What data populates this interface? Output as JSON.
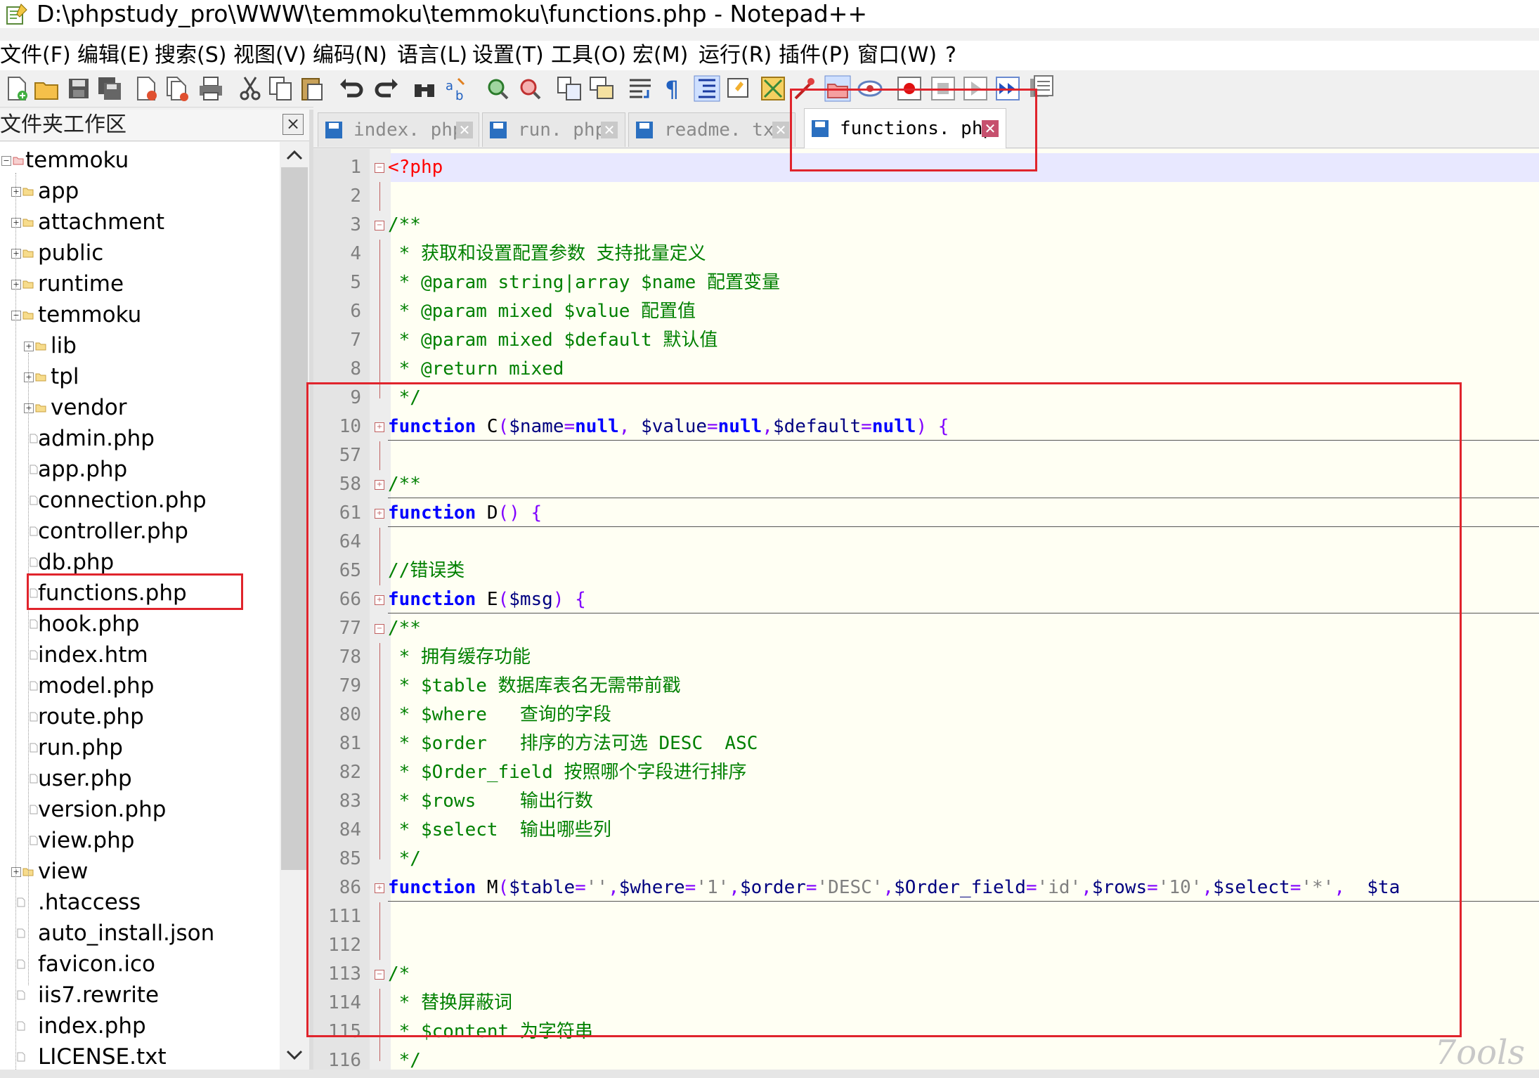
{
  "window": {
    "title": "D:\\phpstudy_pro\\WWW\\temmoku\\temmoku\\functions.php - Notepad++"
  },
  "menu": [
    "文件(F)",
    "编辑(E)",
    "搜索(S)",
    "视图(V)",
    "编码(N)",
    "语言(L)",
    "设置(T)",
    "工具(O)",
    "宏(M)",
    "运行(R)",
    "插件(P)",
    "窗口(W)",
    "?"
  ],
  "toolbar_icons": [
    "new-file-icon",
    "open-file-icon",
    "save-icon",
    "save-all-icon",
    "close-icon",
    "close-all-icon",
    "print-icon",
    "cut-icon",
    "copy-icon",
    "paste-icon",
    "undo-icon",
    "redo-icon",
    "find-icon",
    "replace-icon",
    "zoom-in-icon",
    "zoom-out-icon",
    "sync-vertical-icon",
    "sync-horizontal-icon",
    "word-wrap-icon",
    "show-all-chars-icon",
    "indent-guide-icon",
    "user-language-icon",
    "document-map-icon",
    "function-list-icon",
    "folder-workspace-icon",
    "monitoring-icon",
    "record-macro-icon",
    "stop-macro-icon",
    "play-macro-icon",
    "run-macro-multiple-icon",
    "save-macro-icon"
  ],
  "workspace": {
    "title": "文件夹工作区",
    "close_label": "×",
    "tree": [
      {
        "label": "temmoku",
        "depth": 0,
        "type": "root-open"
      },
      {
        "label": "app",
        "depth": 1,
        "type": "folder"
      },
      {
        "label": "attachment",
        "depth": 1,
        "type": "folder"
      },
      {
        "label": "public",
        "depth": 1,
        "type": "folder"
      },
      {
        "label": "runtime",
        "depth": 1,
        "type": "folder"
      },
      {
        "label": "temmoku",
        "depth": 1,
        "type": "folder-open"
      },
      {
        "label": "lib",
        "depth": 2,
        "type": "folder"
      },
      {
        "label": "tpl",
        "depth": 2,
        "type": "folder"
      },
      {
        "label": "vendor",
        "depth": 2,
        "type": "folder"
      },
      {
        "label": "admin.php",
        "depth": 2,
        "type": "file"
      },
      {
        "label": "app.php",
        "depth": 2,
        "type": "file"
      },
      {
        "label": "connection.php",
        "depth": 2,
        "type": "file"
      },
      {
        "label": "controller.php",
        "depth": 2,
        "type": "file"
      },
      {
        "label": "db.php",
        "depth": 2,
        "type": "file"
      },
      {
        "label": "functions.php",
        "depth": 2,
        "type": "file"
      },
      {
        "label": "hook.php",
        "depth": 2,
        "type": "file"
      },
      {
        "label": "index.htm",
        "depth": 2,
        "type": "file"
      },
      {
        "label": "model.php",
        "depth": 2,
        "type": "file"
      },
      {
        "label": "route.php",
        "depth": 2,
        "type": "file"
      },
      {
        "label": "run.php",
        "depth": 2,
        "type": "file"
      },
      {
        "label": "user.php",
        "depth": 2,
        "type": "file"
      },
      {
        "label": "version.php",
        "depth": 2,
        "type": "file"
      },
      {
        "label": "view.php",
        "depth": 2,
        "type": "file"
      },
      {
        "label": "view",
        "depth": 1,
        "type": "folder"
      },
      {
        "label": ".htaccess",
        "depth": 1,
        "type": "file"
      },
      {
        "label": "auto_install.json",
        "depth": 1,
        "type": "file"
      },
      {
        "label": "favicon.ico",
        "depth": 1,
        "type": "file"
      },
      {
        "label": "iis7.rewrite",
        "depth": 1,
        "type": "file"
      },
      {
        "label": "index.php",
        "depth": 1,
        "type": "file"
      },
      {
        "label": "LICENSE.txt",
        "depth": 1,
        "type": "file"
      }
    ]
  },
  "tabs": [
    {
      "label": "index. php",
      "active": false
    },
    {
      "label": "run. php",
      "active": false
    },
    {
      "label": "readme. txt",
      "active": false
    },
    {
      "label": "functions. php",
      "active": true
    }
  ],
  "tab_close_glyph": "✕",
  "editor": {
    "lines": [
      {
        "n": "1",
        "fold": "open",
        "parts": [
          {
            "c": "c-php",
            "t": "<?php"
          }
        ]
      },
      {
        "n": "2",
        "fold": "line",
        "parts": []
      },
      {
        "n": "3",
        "fold": "open",
        "parts": [
          {
            "c": "c-cm",
            "t": "/**"
          }
        ]
      },
      {
        "n": "4",
        "fold": "line",
        "parts": [
          {
            "c": "c-cm",
            "t": " * 获取和设置配置参数 支持批量定义"
          }
        ]
      },
      {
        "n": "5",
        "fold": "line",
        "parts": [
          {
            "c": "c-cm",
            "t": " * @param string|array $name 配置变量"
          }
        ]
      },
      {
        "n": "6",
        "fold": "line",
        "parts": [
          {
            "c": "c-cm",
            "t": " * @param mixed $value 配置值"
          }
        ]
      },
      {
        "n": "7",
        "fold": "line",
        "parts": [
          {
            "c": "c-cm",
            "t": " * @param mixed $default 默认值"
          }
        ]
      },
      {
        "n": "8",
        "fold": "line",
        "parts": [
          {
            "c": "c-cm",
            "t": " * @return mixed"
          }
        ]
      },
      {
        "n": "9",
        "fold": "end",
        "parts": [
          {
            "c": "c-cm",
            "t": " */"
          }
        ]
      },
      {
        "n": "10",
        "fold": "closed",
        "sep": true,
        "parts": [
          {
            "c": "c-kw",
            "t": "function"
          },
          {
            "c": "c-fn",
            "t": " C"
          },
          {
            "c": "c-op",
            "t": "("
          },
          {
            "c": "c-var",
            "t": "$name"
          },
          {
            "c": "c-op",
            "t": "="
          },
          {
            "c": "c-kw",
            "t": "null"
          },
          {
            "c": "c-op",
            "t": ", "
          },
          {
            "c": "c-var",
            "t": "$value"
          },
          {
            "c": "c-op",
            "t": "="
          },
          {
            "c": "c-kw",
            "t": "null"
          },
          {
            "c": "c-op",
            "t": ","
          },
          {
            "c": "c-var",
            "t": "$default"
          },
          {
            "c": "c-op",
            "t": "="
          },
          {
            "c": "c-kw",
            "t": "null"
          },
          {
            "c": "c-op",
            "t": ") {"
          }
        ]
      },
      {
        "n": "57",
        "fold": "line",
        "parts": []
      },
      {
        "n": "58",
        "fold": "closed",
        "sep": true,
        "parts": [
          {
            "c": "c-cm",
            "t": "/**"
          }
        ]
      },
      {
        "n": "61",
        "fold": "closed",
        "sep": true,
        "parts": [
          {
            "c": "c-kw",
            "t": "function"
          },
          {
            "c": "c-fn",
            "t": " D"
          },
          {
            "c": "c-op",
            "t": "() {"
          }
        ]
      },
      {
        "n": "64",
        "fold": "line",
        "parts": []
      },
      {
        "n": "65",
        "fold": "line",
        "parts": [
          {
            "c": "c-cm",
            "t": "//错误类"
          }
        ]
      },
      {
        "n": "66",
        "fold": "closed",
        "sep": true,
        "parts": [
          {
            "c": "c-kw",
            "t": "function"
          },
          {
            "c": "c-fn",
            "t": " E"
          },
          {
            "c": "c-op",
            "t": "("
          },
          {
            "c": "c-var",
            "t": "$msg"
          },
          {
            "c": "c-op",
            "t": ") {"
          }
        ]
      },
      {
        "n": "77",
        "fold": "open",
        "parts": [
          {
            "c": "c-cm",
            "t": "/**"
          }
        ]
      },
      {
        "n": "78",
        "fold": "line",
        "parts": [
          {
            "c": "c-cm",
            "t": " * 拥有缓存功能"
          }
        ]
      },
      {
        "n": "79",
        "fold": "line",
        "parts": [
          {
            "c": "c-cm",
            "t": " * $table 数据库表名无需带前戳"
          }
        ]
      },
      {
        "n": "80",
        "fold": "line",
        "parts": [
          {
            "c": "c-cm",
            "t": " * $where   查询的字段"
          }
        ]
      },
      {
        "n": "81",
        "fold": "line",
        "parts": [
          {
            "c": "c-cm",
            "t": " * $order   排序的方法可选 DESC  ASC"
          }
        ]
      },
      {
        "n": "82",
        "fold": "line",
        "parts": [
          {
            "c": "c-cm",
            "t": " * $Order_field 按照哪个字段进行排序"
          }
        ]
      },
      {
        "n": "83",
        "fold": "line",
        "parts": [
          {
            "c": "c-cm",
            "t": " * $rows    输出行数"
          }
        ]
      },
      {
        "n": "84",
        "fold": "line",
        "parts": [
          {
            "c": "c-cm",
            "t": " * $select  输出哪些列"
          }
        ]
      },
      {
        "n": "85",
        "fold": "end",
        "parts": [
          {
            "c": "c-cm",
            "t": " */"
          }
        ]
      },
      {
        "n": "86",
        "fold": "closed",
        "sep": true,
        "parts": [
          {
            "c": "c-kw",
            "t": "function"
          },
          {
            "c": "c-fn",
            "t": " M"
          },
          {
            "c": "c-op",
            "t": "("
          },
          {
            "c": "c-var",
            "t": "$table"
          },
          {
            "c": "c-op",
            "t": "="
          },
          {
            "c": "c-str",
            "t": "''"
          },
          {
            "c": "c-op",
            "t": ","
          },
          {
            "c": "c-var",
            "t": "$where"
          },
          {
            "c": "c-op",
            "t": "="
          },
          {
            "c": "c-str",
            "t": "'1'"
          },
          {
            "c": "c-op",
            "t": ","
          },
          {
            "c": "c-var",
            "t": "$order"
          },
          {
            "c": "c-op",
            "t": "="
          },
          {
            "c": "c-str",
            "t": "'DESC'"
          },
          {
            "c": "c-op",
            "t": ","
          },
          {
            "c": "c-var",
            "t": "$Order_field"
          },
          {
            "c": "c-op",
            "t": "="
          },
          {
            "c": "c-str",
            "t": "'id'"
          },
          {
            "c": "c-op",
            "t": ","
          },
          {
            "c": "c-var",
            "t": "$rows"
          },
          {
            "c": "c-op",
            "t": "="
          },
          {
            "c": "c-str",
            "t": "'10'"
          },
          {
            "c": "c-op",
            "t": ","
          },
          {
            "c": "c-var",
            "t": "$select"
          },
          {
            "c": "c-op",
            "t": "="
          },
          {
            "c": "c-str",
            "t": "'*'"
          },
          {
            "c": "c-op",
            "t": ",  "
          },
          {
            "c": "c-var",
            "t": "$ta"
          }
        ]
      },
      {
        "n": "111",
        "fold": "line",
        "parts": []
      },
      {
        "n": "112",
        "fold": "line",
        "parts": []
      },
      {
        "n": "113",
        "fold": "open",
        "parts": [
          {
            "c": "c-cm",
            "t": "/*"
          }
        ]
      },
      {
        "n": "114",
        "fold": "line",
        "parts": [
          {
            "c": "c-cm",
            "t": " * 替换屏蔽词"
          }
        ]
      },
      {
        "n": "115",
        "fold": "line",
        "parts": [
          {
            "c": "c-cm",
            "t": " * $content 为字符串"
          }
        ]
      },
      {
        "n": "116",
        "fold": "end",
        "parts": [
          {
            "c": "c-cm",
            "t": " */"
          }
        ]
      }
    ]
  },
  "watermark": "7ools"
}
